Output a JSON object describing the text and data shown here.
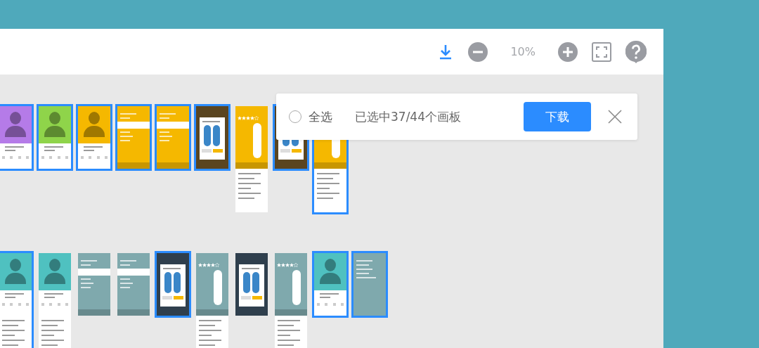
{
  "toolbar": {
    "zoom": "10%"
  },
  "selection_bar": {
    "select_all": {
      "label": "全选",
      "checked": false
    },
    "status": "已选中37/44个画板",
    "download": "下载"
  },
  "artboard_rows": [
    [
      {
        "kind": "profile",
        "color": "#b57be8",
        "selected": true,
        "extended": false
      },
      {
        "kind": "profile",
        "color": "#8fd44a",
        "selected": true,
        "extended": false
      },
      {
        "kind": "profile",
        "color": "#f5b800",
        "selected": true,
        "extended": false
      },
      {
        "kind": "picker",
        "color": "#f5b800",
        "selected": true,
        "extended": false
      },
      {
        "kind": "picker",
        "color": "#f5b800",
        "selected": true,
        "extended": false
      },
      {
        "kind": "modal",
        "color": "#5a4520",
        "selected": true,
        "extended": false
      },
      {
        "kind": "detail",
        "color": "#f5b800",
        "selected": false,
        "extended": true
      },
      {
        "kind": "modal",
        "color": "#5a4520",
        "selected": true,
        "extended": false
      },
      {
        "kind": "detail",
        "color": "#f5b800",
        "selected": true,
        "extended": true
      }
    ],
    [
      {
        "kind": "profile",
        "color": "#4fc1c0",
        "selected": true,
        "extended": true
      },
      {
        "kind": "profile",
        "color": "#4fc1c0",
        "selected": false,
        "extended": true
      },
      {
        "kind": "picker",
        "color": "#7fa9ad",
        "selected": false,
        "extended": false
      },
      {
        "kind": "picker",
        "color": "#7fa9ad",
        "selected": false,
        "extended": false
      },
      {
        "kind": "modal",
        "color": "#2f3f4d",
        "selected": true,
        "extended": false
      },
      {
        "kind": "detail",
        "color": "#7fa9ad",
        "selected": false,
        "extended": true
      },
      {
        "kind": "modal",
        "color": "#2f3f4d",
        "selected": false,
        "extended": false
      },
      {
        "kind": "detail",
        "color": "#7fa9ad",
        "selected": false,
        "extended": true
      },
      {
        "kind": "profile",
        "color": "#4fc1c0",
        "selected": true,
        "extended": false
      },
      {
        "kind": "menu",
        "color": "#7fa9ad",
        "selected": true,
        "extended": false
      }
    ]
  ]
}
